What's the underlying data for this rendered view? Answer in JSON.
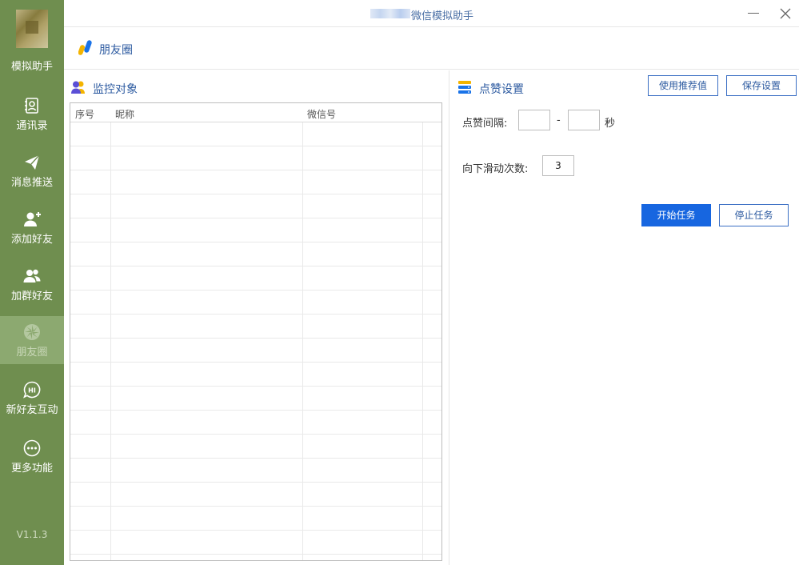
{
  "window": {
    "title": "微信模拟助手"
  },
  "sidebar": {
    "app_name": "模拟助手",
    "version": "V1.1.3",
    "items": [
      {
        "label": "通讯录",
        "icon": "contacts-icon"
      },
      {
        "label": "消息推送",
        "icon": "send-icon"
      },
      {
        "label": "添加好友",
        "icon": "add-friend-icon"
      },
      {
        "label": "加群好友",
        "icon": "group-friends-icon"
      },
      {
        "label": "朋友圈",
        "icon": "moments-icon",
        "active": true
      },
      {
        "label": "新好友互动",
        "icon": "hi-chat-icon"
      },
      {
        "label": "更多功能",
        "icon": "more-icon"
      }
    ]
  },
  "header": {
    "title": "朋友圈"
  },
  "monitor": {
    "title": "监控对象",
    "columns": [
      "序号",
      "昵称",
      "微信号"
    ],
    "rows": []
  },
  "like_settings": {
    "title": "点赞设置",
    "recommend_label": "使用推荐值",
    "save_label": "保存设置",
    "interval_label": "点赞间隔:",
    "interval_min": "",
    "interval_sep": "-",
    "interval_max": "",
    "interval_unit": "秒",
    "scroll_label": "向下滑动次数:",
    "scroll_value": "3",
    "start_label": "开始任务",
    "stop_label": "停止任务"
  },
  "colors": {
    "sidebar_bg": "#6f8e4f",
    "sidebar_active": "#8ca970",
    "accent": "#1766e0",
    "title_text": "#2c5aa0"
  }
}
